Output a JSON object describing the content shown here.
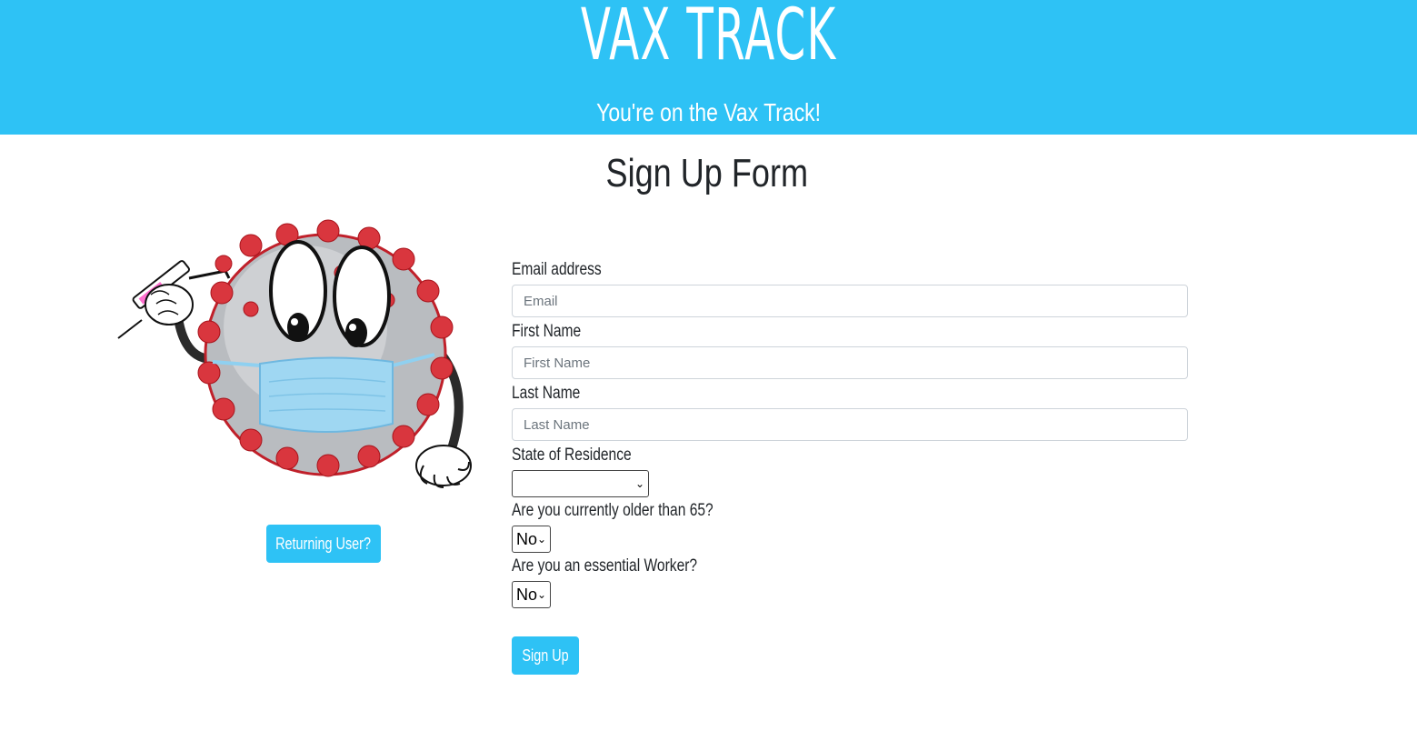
{
  "header": {
    "brand": "VAX TRACK",
    "tagline": "You're on the Vax Track!",
    "background_color": "#2ec2f5"
  },
  "page_title": "Sign Up Form",
  "mascot": {
    "icon": "virus-mascot-with-syringe-and-mask-icon"
  },
  "returning_button": {
    "label": "Returning User?"
  },
  "form": {
    "email": {
      "label": "Email address",
      "placeholder": "Email",
      "value": ""
    },
    "first_name": {
      "label": "First Name",
      "placeholder": "First Name",
      "value": ""
    },
    "last_name": {
      "label": "Last Name",
      "placeholder": "Last Name",
      "value": ""
    },
    "state": {
      "label": "State of Residence",
      "value": ""
    },
    "older_65": {
      "label": "Are you currently older than 65?",
      "value": "No"
    },
    "essential": {
      "label": "Are you an essential Worker?",
      "value": "No"
    },
    "submit_label": "Sign Up"
  },
  "accent_color": "#2ec2f5"
}
